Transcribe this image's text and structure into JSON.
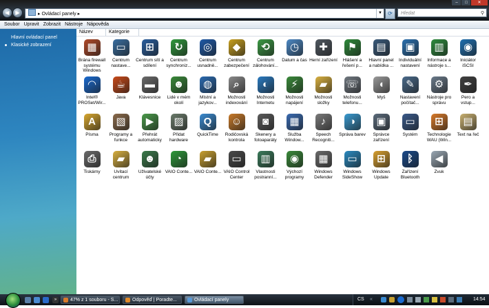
{
  "window": {
    "breadcrumb": [
      "Ovládací panely"
    ],
    "search_placeholder": "Hledat"
  },
  "menu": [
    "Soubor",
    "Upravit",
    "Zobrazit",
    "Nástroje",
    "Nápověda"
  ],
  "sidebar": {
    "home_link": "Hlavní ovládací panel",
    "classic_link": "Klasické zobrazení"
  },
  "columns": [
    "Název",
    "Kategorie"
  ],
  "items": [
    {
      "label": "Brána firewall systému Windows",
      "icon": "firewall-icon",
      "color": "#b04a2a",
      "glyph": "▦"
    },
    {
      "label": "Centrum nastave...",
      "icon": "mobility-icon",
      "color": "#3a6ea0",
      "glyph": "▭"
    },
    {
      "label": "Centrum sítí a sdílení",
      "icon": "network-icon",
      "color": "#2a5e9e",
      "glyph": "⊞"
    },
    {
      "label": "Centrum synchroniz...",
      "icon": "sync-icon",
      "color": "#2f9a3c",
      "glyph": "↻"
    },
    {
      "label": "Centrum usnadně...",
      "icon": "accessibility-icon",
      "color": "#1f5aa8",
      "glyph": "◎"
    },
    {
      "label": "Centrum zabezpečení",
      "icon": "security-shield-icon",
      "color": "#c8a020",
      "glyph": "◆"
    },
    {
      "label": "Centrum zálohování...",
      "icon": "backup-icon",
      "color": "#3c9a44",
      "glyph": "⟲"
    },
    {
      "label": "Datum a čas",
      "icon": "calendar-clock-icon",
      "color": "#4c88c4",
      "glyph": "◷"
    },
    {
      "label": "Herní zařízení",
      "icon": "gamepad-icon",
      "color": "#505860",
      "glyph": "✚"
    },
    {
      "label": "Hlášení a řešení p...",
      "icon": "problem-reports-icon",
      "color": "#2e8a3a",
      "glyph": "⚑"
    },
    {
      "label": "Hlavní panel a nabídka ...",
      "icon": "taskbar-icon",
      "color": "#3a5a7a",
      "glyph": "▤"
    },
    {
      "label": "Individuální nastavení",
      "icon": "personalization-icon",
      "color": "#2a70b0",
      "glyph": "▣"
    },
    {
      "label": "Informace a nástroje s...",
      "icon": "performance-icon",
      "color": "#2e8c3e",
      "glyph": "▥"
    },
    {
      "label": "Iniciátor iSCSI",
      "icon": "iscsi-icon",
      "color": "#1f6fb0",
      "glyph": "◉"
    },
    {
      "label": "Intel® PROSet/Wir...",
      "icon": "wireless-icon",
      "color": "#1a6ad0",
      "glyph": "◠"
    },
    {
      "label": "Java",
      "icon": "java-icon",
      "color": "#c84a1a",
      "glyph": "☕"
    },
    {
      "label": "Klávesnice",
      "icon": "keyboard-icon",
      "color": "#6a6a6a",
      "glyph": "▬"
    },
    {
      "label": "Lidé v mém okolí",
      "icon": "people-icon",
      "color": "#3a8a3a",
      "glyph": "☻"
    },
    {
      "label": "Místní a jazykov...",
      "icon": "globe-clock-icon",
      "color": "#2a6ab0",
      "glyph": "◍"
    },
    {
      "label": "Možnosti indexování",
      "icon": "indexing-icon",
      "color": "#8a8a8a",
      "glyph": "⌕"
    },
    {
      "label": "Možnosti Internetu",
      "icon": "internet-options-icon",
      "color": "#2a7ac0",
      "glyph": "◐"
    },
    {
      "label": "Možnosti napájení",
      "icon": "power-icon",
      "color": "#3a8a3a",
      "glyph": "⚡"
    },
    {
      "label": "Možnosti složky",
      "icon": "folder-options-icon",
      "color": "#d8b040",
      "glyph": "▰"
    },
    {
      "label": "Možnosti telefonu...",
      "icon": "phone-modem-icon",
      "color": "#707880",
      "glyph": "☏"
    },
    {
      "label": "Myš",
      "icon": "mouse-icon",
      "color": "#9a9a9a",
      "glyph": "◖"
    },
    {
      "label": "Nastavení počítač...",
      "icon": "tablet-pc-icon",
      "color": "#4a6a8a",
      "glyph": "✎"
    },
    {
      "label": "Nástroje pro správu",
      "icon": "admin-tools-icon",
      "color": "#6a7a8a",
      "glyph": "⚙"
    },
    {
      "label": "Pero a vstup...",
      "icon": "pen-input-icon",
      "color": "#404040",
      "glyph": "✒"
    },
    {
      "label": "Písma",
      "icon": "fonts-icon",
      "color": "#d8a830",
      "glyph": "A"
    },
    {
      "label": "Programy a funkce",
      "icon": "programs-icon",
      "color": "#8a6a4a",
      "glyph": "▧"
    },
    {
      "label": "Přehrát automaticky",
      "icon": "autoplay-icon",
      "color": "#4a9a4a",
      "glyph": "▶"
    },
    {
      "label": "Přidat hardware",
      "icon": "add-hardware-icon",
      "color": "#6a7a6a",
      "glyph": "▨"
    },
    {
      "label": "QuickTime",
      "icon": "quicktime-icon",
      "color": "#3a8ad0",
      "glyph": "Q"
    },
    {
      "label": "Rodičovská kontrola",
      "icon": "parental-controls-icon",
      "color": "#c87a2a",
      "glyph": "☺"
    },
    {
      "label": "Skenery a fotoaparáty",
      "icon": "scanner-camera-icon",
      "color": "#5a5a5a",
      "glyph": "◙"
    },
    {
      "label": "Služba Window...",
      "icon": "windows-service-icon",
      "color": "#3a6ab0",
      "glyph": "▦"
    },
    {
      "label": "Speech Recogniti...",
      "icon": "microphone-icon",
      "color": "#7a7a7a",
      "glyph": "♪"
    },
    {
      "label": "Správa barev",
      "icon": "color-management-icon",
      "color": "#3a9ad0",
      "glyph": "◑"
    },
    {
      "label": "Správce zařízení",
      "icon": "device-manager-icon",
      "color": "#5a6a7a",
      "glyph": "▣"
    },
    {
      "label": "Systém",
      "icon": "system-icon",
      "color": "#3a5a8a",
      "glyph": "▭"
    },
    {
      "label": "Technologie WAU (Win...",
      "icon": "windows-flag-icon",
      "color": "#d87a2a",
      "glyph": "⊞"
    },
    {
      "label": "Text na řeč",
      "icon": "text-to-speech-icon",
      "color": "#c8b070",
      "glyph": "▤"
    },
    {
      "label": "Tiskárny",
      "icon": "printer-icon",
      "color": "#6a6a6a",
      "glyph": "⎙"
    },
    {
      "label": "Uvítací centrum",
      "icon": "welcome-center-icon",
      "color": "#d8b040",
      "glyph": "▰"
    },
    {
      "label": "Uživatelské účty",
      "icon": "user-accounts-icon",
      "color": "#3a7a4a",
      "glyph": "☻"
    },
    {
      "label": "VAIO Conte...",
      "icon": "vaio-content-icon",
      "color": "#2e9a3a",
      "glyph": "◔"
    },
    {
      "label": "VAIO Conte...",
      "icon": "vaio-folder-icon",
      "color": "#c8a030",
      "glyph": "▰"
    },
    {
      "label": "VAIO Control Center",
      "icon": "vaio-control-center-icon",
      "color": "#4a4a4a",
      "glyph": "▭"
    },
    {
      "label": "Vlastnosti postranní...",
      "icon": "sidebar-properties-icon",
      "color": "#3a7a5a",
      "glyph": "▥"
    },
    {
      "label": "Výchozí programy",
      "icon": "default-programs-icon",
      "color": "#3a8a3a",
      "glyph": "◉"
    },
    {
      "label": "Windows Defender",
      "icon": "windows-defender-icon",
      "color": "#6a6a6a",
      "glyph": "▦"
    },
    {
      "label": "Windows SideShow",
      "icon": "sideshow-icon",
      "color": "#2a8ac0",
      "glyph": "▭"
    },
    {
      "label": "Windows Update",
      "icon": "windows-update-icon",
      "color": "#d8a030",
      "glyph": "⊞"
    },
    {
      "label": "Zařízení Bluetooth",
      "icon": "bluetooth-icon",
      "color": "#1a4a8a",
      "glyph": "ᛒ"
    },
    {
      "label": "Zvuk",
      "icon": "speaker-icon",
      "color": "#9aa8b4",
      "glyph": "◀"
    }
  ],
  "taskbar": {
    "buttons": [
      "47% z 1 souboru - S...",
      "Odpověď | Poradte...",
      "Ovládací panely"
    ],
    "language": "CS",
    "clock": "14:54"
  },
  "colors": {
    "sidebar_top": "#1e6aa8",
    "sidebar_bottom": "#62b28c",
    "titlebar": "#1a1a1a"
  }
}
